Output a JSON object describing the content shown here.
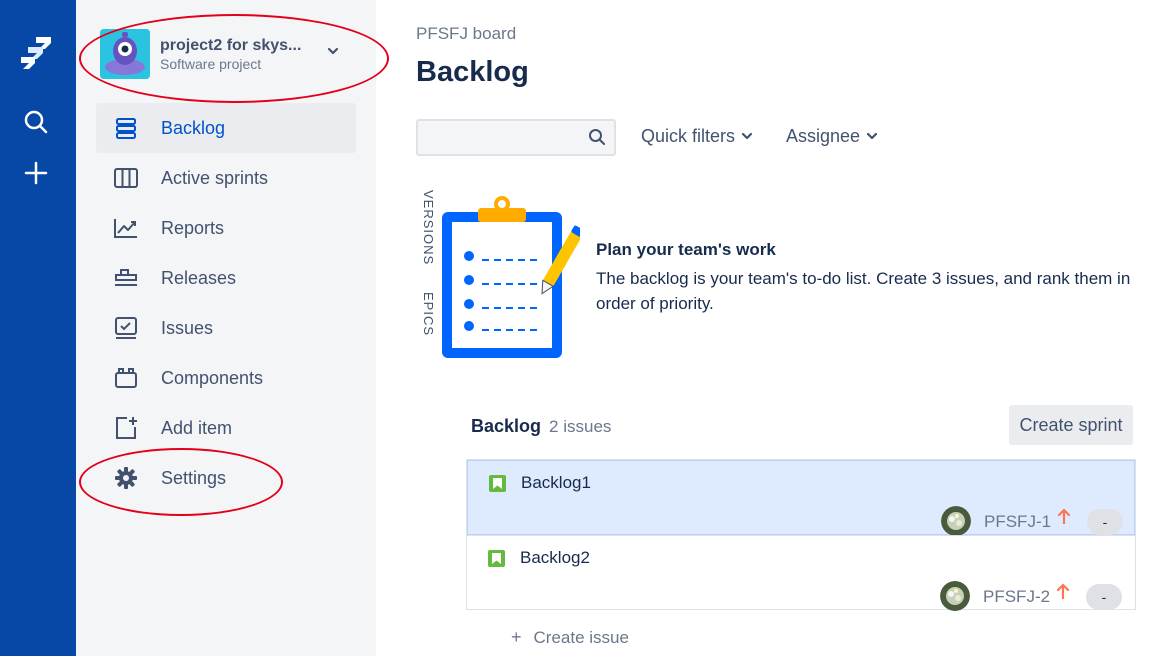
{
  "global_nav": {
    "icons": [
      "jira-logo-icon",
      "search-icon",
      "create-plus-icon"
    ]
  },
  "sidebar": {
    "project_name": "project2 for skys...",
    "project_type": "Software project",
    "items": [
      {
        "label": "Backlog",
        "icon": "backlog-icon",
        "active": true
      },
      {
        "label": "Active sprints",
        "icon": "board-columns-icon",
        "active": false
      },
      {
        "label": "Reports",
        "icon": "chart-icon",
        "active": false
      },
      {
        "label": "Releases",
        "icon": "ship-icon",
        "active": false
      },
      {
        "label": "Issues",
        "icon": "issues-icon",
        "active": false
      },
      {
        "label": "Components",
        "icon": "components-icon",
        "active": false
      },
      {
        "label": "Add item",
        "icon": "add-item-icon",
        "active": false
      },
      {
        "label": "Settings",
        "icon": "gear-icon",
        "active": false
      }
    ]
  },
  "main": {
    "breadcrumb": "PFSFJ board",
    "title": "Backlog",
    "search": {
      "placeholder": ""
    },
    "filters": {
      "quick_filters": "Quick filters",
      "assignee": "Assignee"
    },
    "side_tabs": {
      "versions": "VERSIONS",
      "epics": "EPICS"
    },
    "empty_state": {
      "title": "Plan your team's work",
      "description": "The backlog is your team's to-do list. Create 3 issues, and rank them in order of priority."
    },
    "backlog": {
      "title": "Backlog",
      "count": "2 issues",
      "create_sprint": "Create sprint",
      "issues": [
        {
          "summary": "Backlog1",
          "key": "PFSFJ-1",
          "estimate": "-",
          "selected": true
        },
        {
          "summary": "Backlog2",
          "key": "PFSFJ-2",
          "estimate": "-",
          "selected": false
        }
      ],
      "create_issue": "Create issue"
    }
  },
  "colors": {
    "global_nav": "#0747a6",
    "sidebar_bg": "#f4f5f7",
    "active_text": "#0052cc",
    "selected_row": "#deebff",
    "story_green": "#63ba3c",
    "priority_orange": "#ff7452",
    "annotation_red": "#e2001a"
  }
}
